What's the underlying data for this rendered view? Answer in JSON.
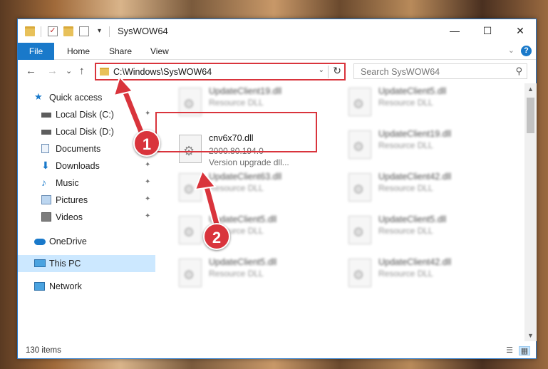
{
  "window": {
    "title": "SysWOW64"
  },
  "window_controls": {
    "minimize": "—",
    "maximize": "☐",
    "close": "✕"
  },
  "ribbon": {
    "file_tab": "File",
    "tabs": [
      "Home",
      "Share",
      "View"
    ],
    "collapse_glyph": "⌄",
    "help_glyph": "?"
  },
  "nav": {
    "back_glyph": "←",
    "forward_glyph": "→",
    "recent_glyph": "⌄",
    "up_glyph": "↑",
    "address_path": "C:\\Windows\\SysWOW64",
    "address_drop_glyph": "⌄",
    "refresh_glyph": "↻",
    "search_placeholder": "Search SysWOW64",
    "search_glyph": "⚲"
  },
  "sidebar": {
    "items": [
      {
        "label": "Quick access",
        "icon": "star-icon",
        "pinned": false
      },
      {
        "label": "Local Disk (C:)",
        "icon": "drive-icon",
        "pinned": true
      },
      {
        "label": "Local Disk (D:)",
        "icon": "drive-icon",
        "pinned": false
      },
      {
        "label": "Documents",
        "icon": "documents-icon",
        "pinned": true
      },
      {
        "label": "Downloads",
        "icon": "downloads-icon",
        "pinned": true
      },
      {
        "label": "Music",
        "icon": "music-icon",
        "pinned": true
      },
      {
        "label": "Pictures",
        "icon": "pictures-icon",
        "pinned": true
      },
      {
        "label": "Videos",
        "icon": "videos-icon",
        "pinned": true
      },
      {
        "label": "OneDrive",
        "icon": "cloud-icon",
        "pinned": false
      },
      {
        "label": "This PC",
        "icon": "computer-icon",
        "pinned": false,
        "selected": true
      },
      {
        "label": "Network",
        "icon": "network-icon",
        "pinned": false
      }
    ],
    "pin_glyph": "📌"
  },
  "files": [
    {
      "name": "UpdateClient19.dll",
      "line2": "Resource DLL",
      "line3": "",
      "blurred": true
    },
    {
      "name": "UpdateClient5.dll",
      "line2": "Resource DLL",
      "line3": "",
      "blurred": true
    },
    {
      "name": "cnv6x70.dll",
      "line2": "2000.80.194.0",
      "line3": "Version upgrade dll...",
      "blurred": false
    },
    {
      "name": "UpdateClient19.dll",
      "line2": "Resource DLL",
      "line3": "",
      "blurred": true
    },
    {
      "name": "UpdateClient63.dll",
      "line2": "Resource DLL",
      "line3": "",
      "blurred": true
    },
    {
      "name": "UpdateClient42.dll",
      "line2": "Resource DLL",
      "line3": "",
      "blurred": true
    },
    {
      "name": "UpdateClient5.dll",
      "line2": "Resource DLL",
      "line3": "",
      "blurred": true
    },
    {
      "name": "UpdateClient5.dll",
      "line2": "Resource DLL",
      "line3": "",
      "blurred": true
    },
    {
      "name": "UpdateClient5.dll",
      "line2": "Resource DLL",
      "line3": "",
      "blurred": true
    },
    {
      "name": "UpdateClient42.dll",
      "line2": "Resource DLL",
      "line3": "",
      "blurred": true
    }
  ],
  "status": {
    "item_count": "130 items"
  },
  "annotations": {
    "step1": "1",
    "step2": "2"
  },
  "colors": {
    "accent": "#1979ca",
    "highlight": "#d9343c",
    "selected": "#cce8ff",
    "folder": "#e8c15a"
  }
}
